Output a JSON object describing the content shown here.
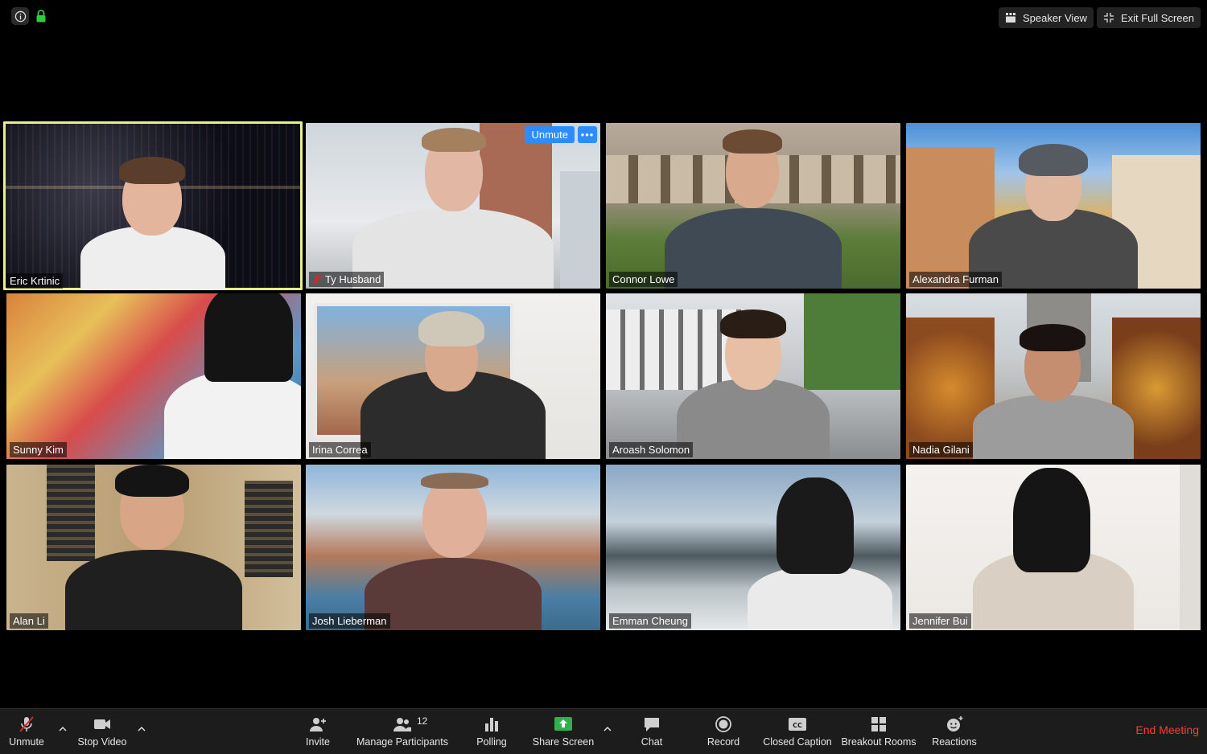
{
  "window": {
    "speaker_view_label": "Speaker View",
    "exit_full_screen_label": "Exit Full Screen"
  },
  "video_tile_actions": {
    "unmute_label": "Unmute",
    "more_label": "•••"
  },
  "participants": [
    {
      "name": "Eric Krtinic",
      "active": true,
      "muted": false
    },
    {
      "name": "Ty Husband",
      "active": false,
      "muted": true
    },
    {
      "name": "Connor Lowe",
      "active": false,
      "muted": false
    },
    {
      "name": "Alexandra Furman",
      "active": false,
      "muted": false
    },
    {
      "name": "Sunny Kim",
      "active": false,
      "muted": false
    },
    {
      "name": "Irina Correa",
      "active": false,
      "muted": false
    },
    {
      "name": "Aroash Solomon",
      "active": false,
      "muted": false
    },
    {
      "name": "Nadia Gilani",
      "active": false,
      "muted": false
    },
    {
      "name": "Alan Li",
      "active": false,
      "muted": false
    },
    {
      "name": "Josh Lieberman",
      "active": false,
      "muted": false
    },
    {
      "name": "Emman Cheung",
      "active": false,
      "muted": false
    },
    {
      "name": "Jennifer Bui",
      "active": false,
      "muted": false
    }
  ],
  "toolbar": {
    "unmute_label": "Unmute",
    "stop_video_label": "Stop Video",
    "invite_label": "Invite",
    "manage_participants_label": "Manage Participants",
    "participant_count": "12",
    "polling_label": "Polling",
    "share_screen_label": "Share Screen",
    "chat_label": "Chat",
    "record_label": "Record",
    "closed_caption_label": "Closed Caption",
    "breakout_rooms_label": "Breakout Rooms",
    "reactions_label": "Reactions",
    "end_meeting_label": "End Meeting"
  },
  "colors": {
    "active_speaker_border": "#e6f08a",
    "accent_blue": "#2d8cff",
    "share_green": "#2fb04a",
    "end_red": "#ff3b30",
    "lock_green": "#2ecc40",
    "mute_red": "#e02424"
  }
}
